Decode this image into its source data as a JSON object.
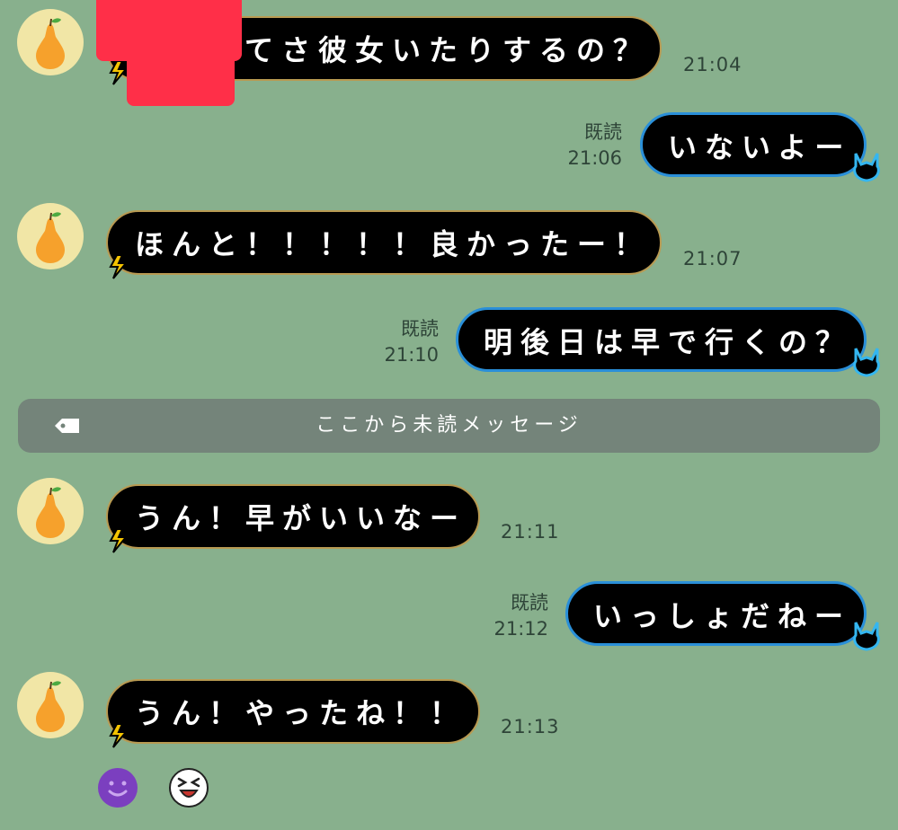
{
  "messages": [
    {
      "side": "in",
      "text": "てさ彼女いたりするの？",
      "time": "21:04"
    },
    {
      "side": "out",
      "text": "いないよー",
      "read": "既読",
      "time": "21:06"
    },
    {
      "side": "in",
      "text": "ほんと！！！！！良かったー！",
      "time": "21:07"
    },
    {
      "side": "out",
      "text": "明後日は早で行くの？",
      "read": "既読",
      "time": "21:10"
    },
    {
      "side": "in",
      "text": "うん！早がいいなー",
      "time": "21:11"
    },
    {
      "side": "out",
      "text": "いっしょだねー",
      "read": "既読",
      "time": "21:12"
    },
    {
      "side": "in",
      "text": "うん！やったね！！",
      "time": "21:13"
    }
  ],
  "divider": {
    "label": "ここから未読メッセージ",
    "icon": "tag-icon"
  },
  "avatar_icon": "pear-icon",
  "reactions": [
    "smile-emoji-icon",
    "laughing-emoji-icon"
  ],
  "colors": {
    "background": "#88b08d",
    "bubble": "#000000",
    "divider": "#74847a",
    "redaction": "#ff2f48",
    "avatar_bg": "#f1e6a6",
    "pear": "#f6a12c"
  }
}
